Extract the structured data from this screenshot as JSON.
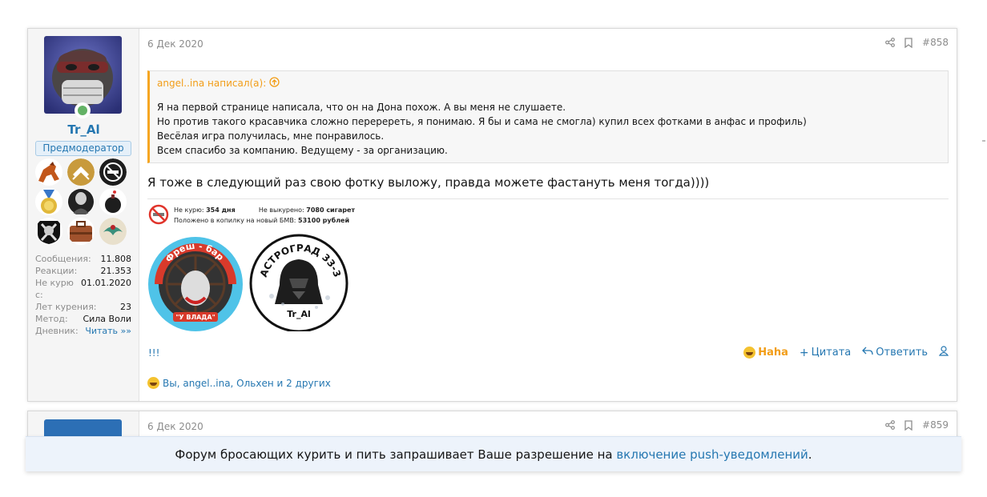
{
  "post1": {
    "date": "6 Дек 2020",
    "number": "#858",
    "user": {
      "name": "Tr_Al",
      "role": "Предмодератор",
      "stats": [
        {
          "label": "Сообщения:",
          "value": "11.808"
        },
        {
          "label": "Реакции:",
          "value": "21.353"
        },
        {
          "label": "Не курю с:",
          "value": "01.01.2020"
        },
        {
          "label": "Лет курения:",
          "value": "23"
        },
        {
          "label": "Метод:",
          "value": "Сила Воли"
        },
        {
          "label": "Дневник:",
          "value": "Читать »»"
        }
      ]
    },
    "quote": {
      "author": "angel..ina написал(а):",
      "lines": [
        "Я на первой странице написала, что он на Дона похож. А вы меня не слушаете.",
        "Но против такого красавчика сложно переререть, я понимаю. Я бы и сама не смогла) купил всех фотками в анфас и профиль)",
        "Весёлая игра получилась, мне понравилось.",
        "Всем спасибо за компанию. Ведущему - за организацию."
      ]
    },
    "message": "Я тоже в следующий раз свою фотку выложу, правда можете фастануть меня тогда))))",
    "quit_stats": {
      "not_smoking_label": "Не курю:",
      "not_smoking_value": "354 дня",
      "not_smoked_label": "Не выкурено:",
      "not_smoked_value": "7080 сигарет",
      "saved_label": "Положено в копилку на новый БМВ:",
      "saved_value": "53100 рублей"
    },
    "banner1": {
      "arc_text": "Фреш - бар",
      "bottom_text": "\"У ВЛАДА\""
    },
    "banner2": {
      "arc_text": "АСТРОГРАД 33-3",
      "bottom_text": "Tr_Al"
    },
    "signature_text": "!!!",
    "actions": {
      "reaction": "Haha",
      "quote": "Цитата",
      "reply": "Ответить"
    },
    "reactions_list": "Вы, angel..ina, Ольхен и 2 других"
  },
  "post2": {
    "date": "6 Дек 2020",
    "number": "#859"
  },
  "push": {
    "text": "Форум бросающих курить и пить запрашивает Ваше разрешение на ",
    "link": "включение push-уведомлений",
    "end": "."
  },
  "colors": {
    "link": "#2577b1",
    "quote_accent": "#f6a622",
    "online": "#63b265"
  }
}
